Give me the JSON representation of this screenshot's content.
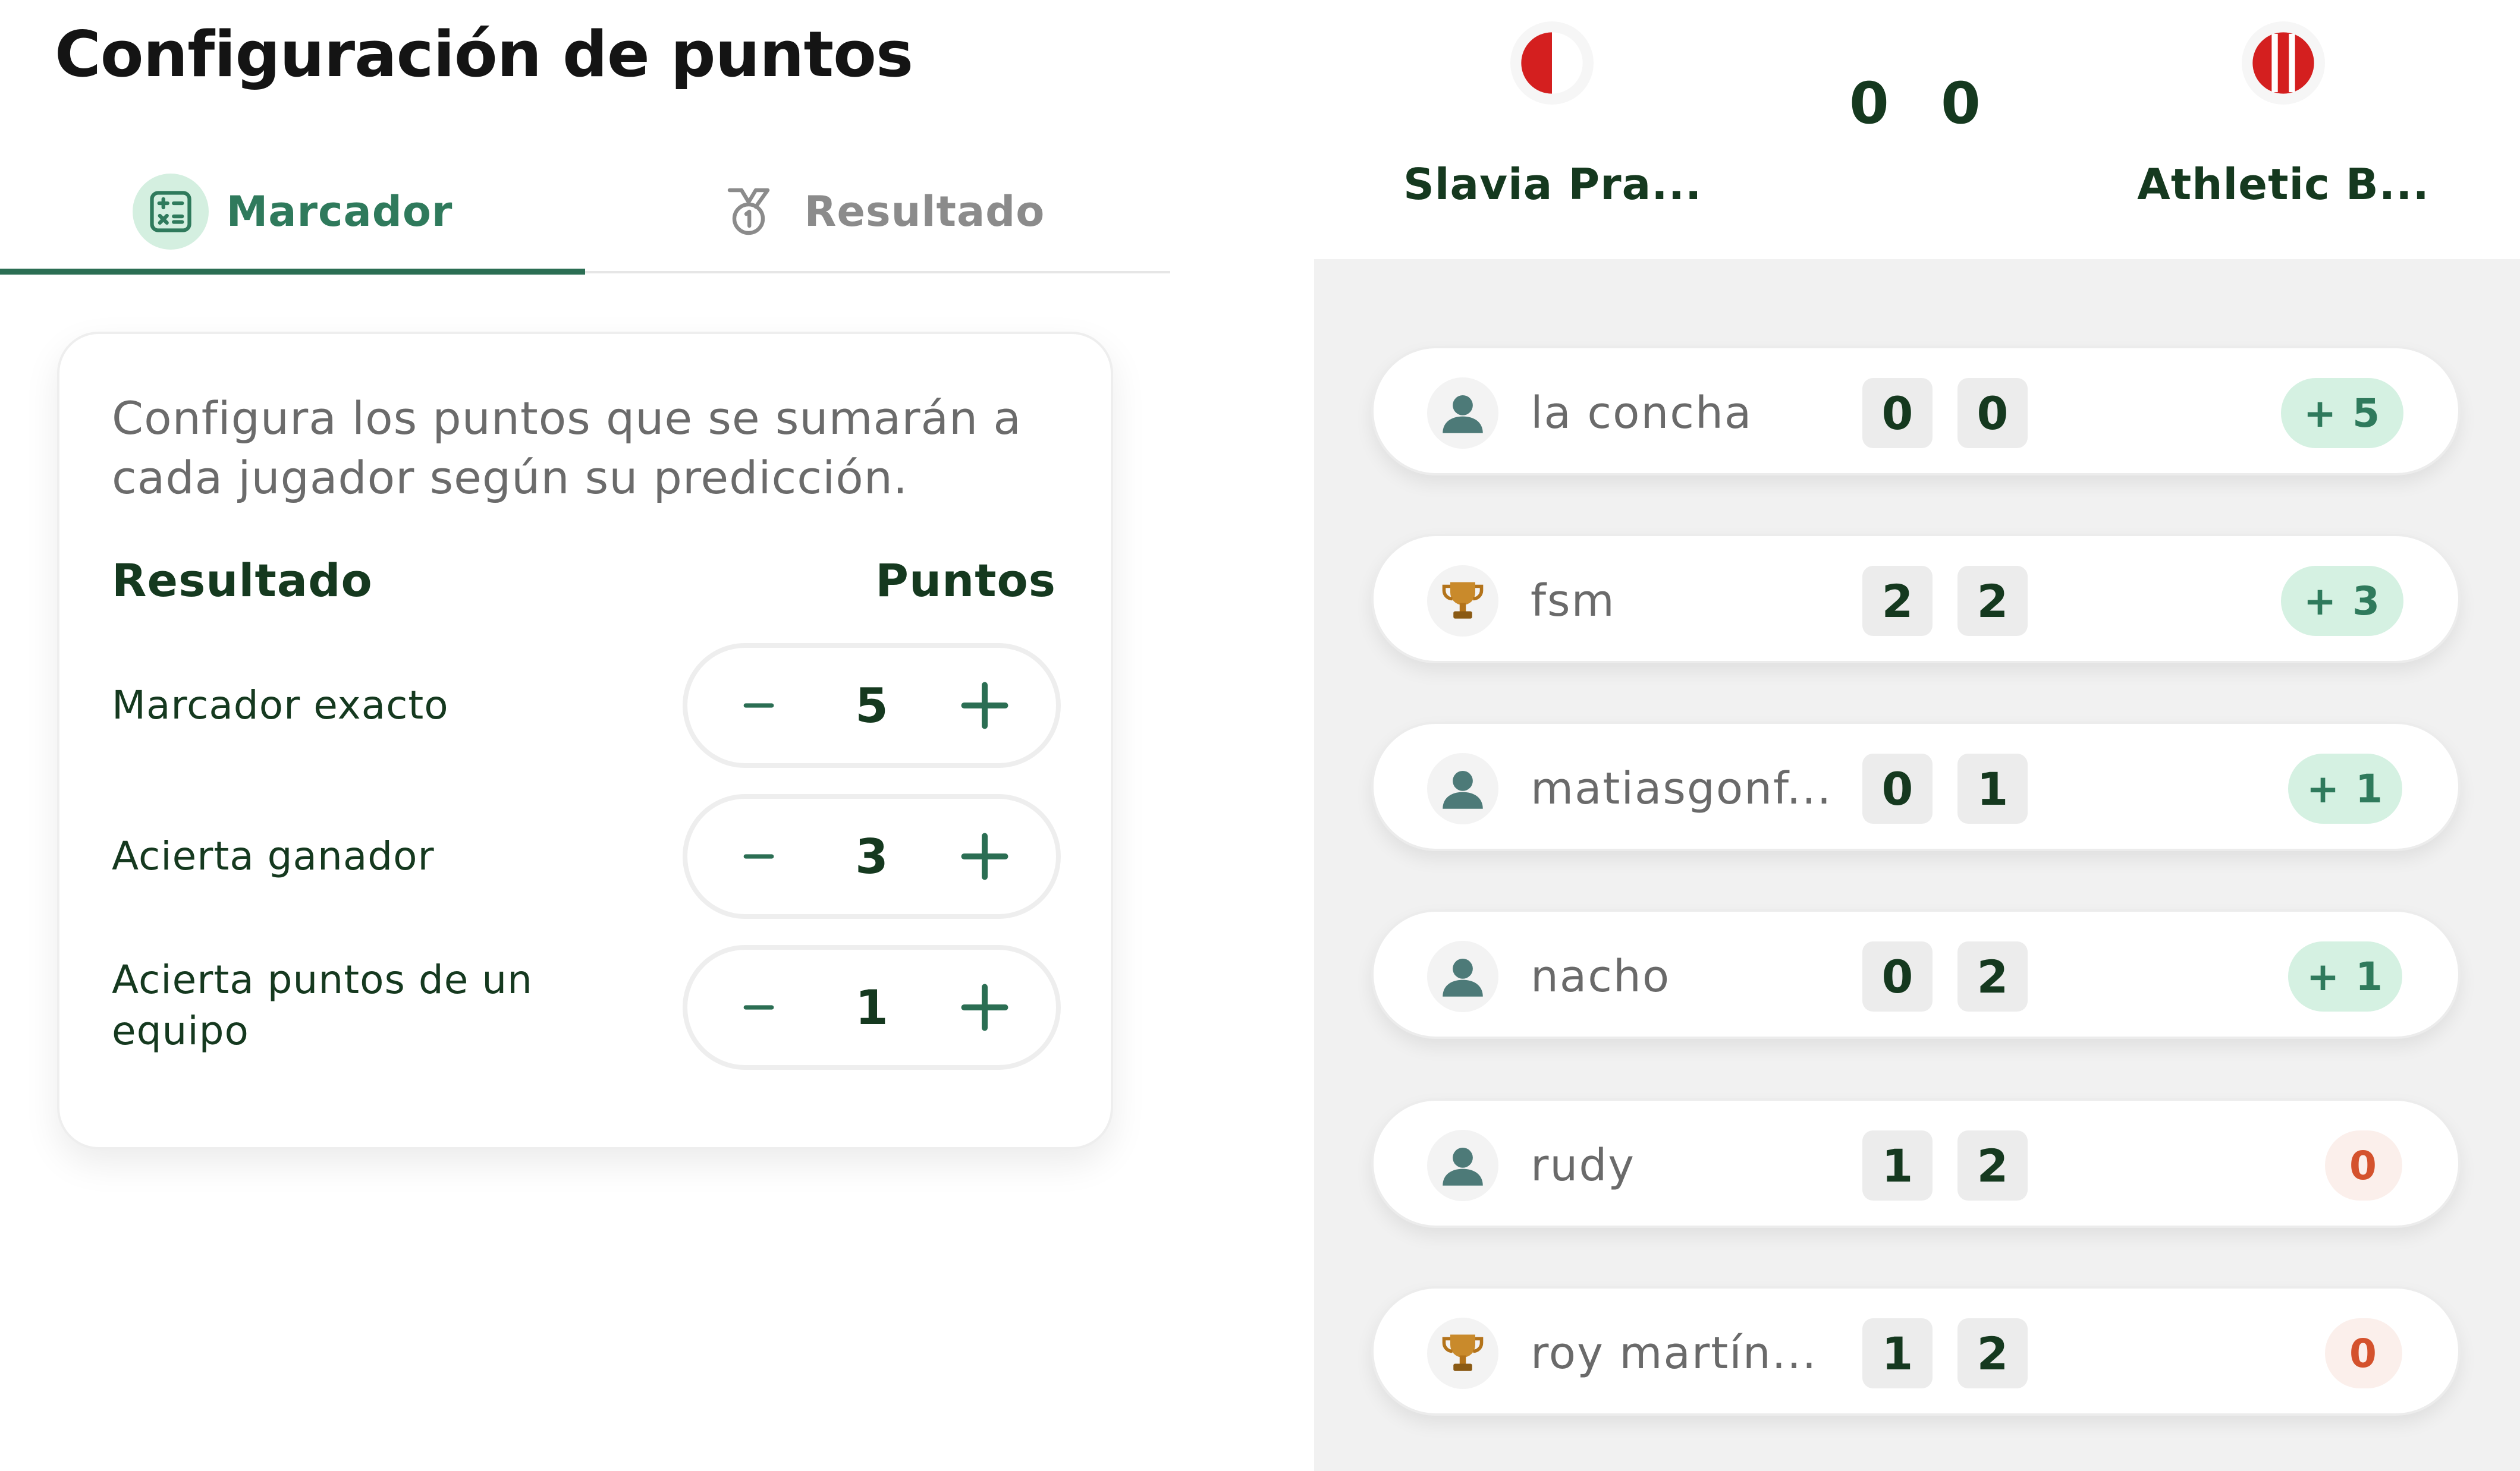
{
  "config": {
    "title": "Configuración de puntos",
    "tabs": [
      {
        "label": "Marcador",
        "icon": "calculator-icon",
        "active": true
      },
      {
        "label": "Resultado",
        "icon": "medal-icon",
        "active": false
      }
    ],
    "description": "Configura los puntos que se sumarán a cada jugador según su predicción.",
    "col_left": "Resultado",
    "col_right": "Puntos",
    "rules": [
      {
        "label": "Marcador exacto",
        "value": "5"
      },
      {
        "label": "Acierta ganador",
        "value": "3"
      },
      {
        "label": "Acierta puntos de un equipo",
        "value": "1"
      }
    ]
  },
  "match": {
    "home": {
      "name": "Slavia Pra...",
      "score": "0",
      "crest_colors": [
        "#ffffff",
        "#d41f1f"
      ]
    },
    "away": {
      "name": "Athletic B...",
      "score": "0",
      "crest_colors": [
        "#d41f1f",
        "#ffffff"
      ]
    }
  },
  "predictions": [
    {
      "user": "la concha",
      "avatar": "user-icon",
      "home": "0",
      "away": "0",
      "points": "+ 5"
    },
    {
      "user": "fsm",
      "avatar": "trophy-icon",
      "home": "2",
      "away": "2",
      "points": "+ 3"
    },
    {
      "user": "matiasgonf...",
      "avatar": "user-icon",
      "home": "0",
      "away": "1",
      "points": "+ 1"
    },
    {
      "user": "nacho",
      "avatar": "user-icon",
      "home": "0",
      "away": "2",
      "points": "+ 1"
    },
    {
      "user": "rudy",
      "avatar": "user-icon",
      "home": "1",
      "away": "2",
      "points": "0"
    },
    {
      "user": "roy martín...",
      "avatar": "trophy-icon",
      "home": "1",
      "away": "2",
      "points": "0"
    }
  ],
  "colors": {
    "accent": "#2b6e53",
    "positive_badge": "#d5f1e2",
    "zero_badge": "#fbefeb",
    "zero_text": "#d4522d"
  }
}
